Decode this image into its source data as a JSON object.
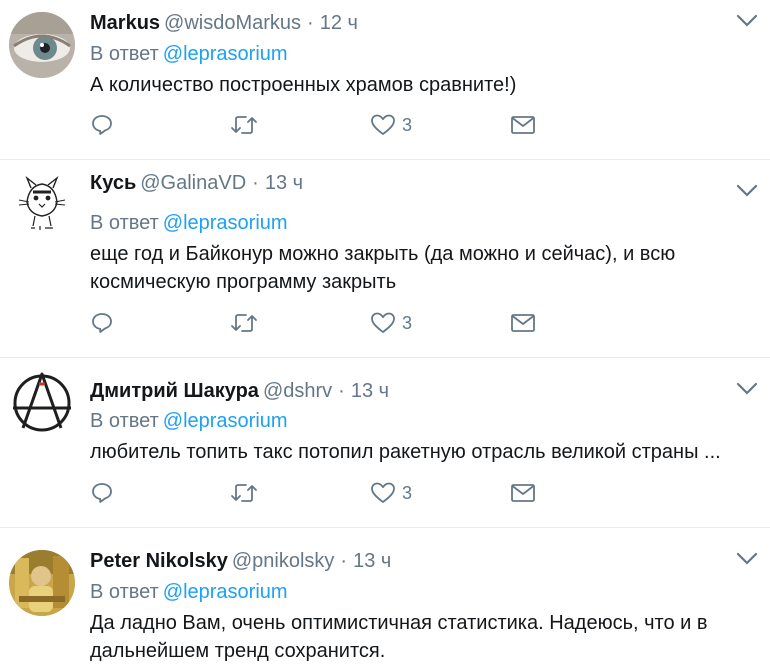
{
  "tweets": [
    {
      "name": "Markus",
      "handle": "@wisdoMarkus",
      "sep": "·",
      "time": "12 ч",
      "reply_prefix": "В ответ",
      "reply_to": "@leprasorium",
      "text": "А количество построенных храмов сравните!)",
      "likes": "3"
    },
    {
      "name": "Кусь",
      "handle": "@GalinaVD",
      "sep": "·",
      "time": "13 ч",
      "reply_prefix": "В ответ",
      "reply_to": "@leprasorium",
      "text": "еще год и Байконур можно закрыть (да можно и сейчас), и всю космическую программу закрыть",
      "likes": "3"
    },
    {
      "name": "Дмитрий Шакура",
      "handle": "@dshrv",
      "sep": "·",
      "time": "13 ч",
      "reply_prefix": "В ответ",
      "reply_to": "@leprasorium",
      "text": "любитель топить такс потопил ракетную отрасль великой страны ...",
      "likes": "3"
    },
    {
      "name": "Peter Nikolsky",
      "handle": "@pnikolsky",
      "sep": "·",
      "time": "13 ч",
      "reply_prefix": "В ответ",
      "reply_to": "@leprasorium",
      "text": "Да ладно Вам, очень оптимистичная статистика. Надеюсь, что и в дальнейшем тренд сохранится.",
      "likes": ""
    }
  ],
  "colors": {
    "link": "#1da1f2",
    "muted": "#657786",
    "text": "#14171a",
    "divider": "#e6ecf0"
  },
  "icons": {
    "reply": "reply-icon",
    "retweet": "retweet-icon",
    "like": "heart-icon",
    "dm": "envelope-icon",
    "menu": "chevron-down-icon"
  }
}
